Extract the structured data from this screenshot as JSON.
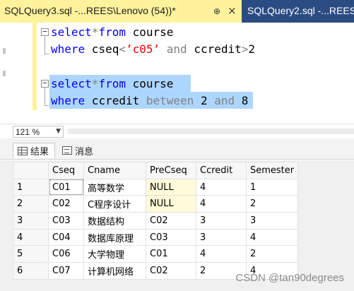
{
  "tabs": {
    "active_title": "SQLQuery3.sql -...REES\\Lenovo (54))*",
    "pin_glyph": "⊕",
    "close_glyph": "×",
    "inactive_title": "SQLQuery2.sql -...REES\\Le"
  },
  "editor": {
    "fold_glyph": "−",
    "query1": {
      "line1": {
        "kw1": "select",
        "op1": "*",
        "kw2": "from",
        "rest": " course"
      },
      "line2": {
        "kw1": "where",
        "txt1": " cseq",
        "op1": "<",
        "str1": "’c05’",
        "op2": " and ",
        "txt2": "ccredit",
        "op3": ">",
        "txt3": "2"
      }
    },
    "query2": {
      "line1": {
        "kw1": "select",
        "op1": "*",
        "kw2": "from",
        "rest": " course"
      },
      "line2": {
        "kw1": "where",
        "txt1": " ccredit ",
        "op1": "between",
        "txt2": " 2 ",
        "kw2": "and",
        "txt3": " 8"
      }
    }
  },
  "status": {
    "zoom": "121 %",
    "zoom_arrow": "▼"
  },
  "results": {
    "tab_results": "结果",
    "tab_messages": "消息",
    "columns": [
      "Cseq",
      "Cname",
      "PreCseq",
      "Ccredit",
      "Semester"
    ],
    "rows": [
      [
        "1",
        "C01",
        "高等数学",
        "NULL",
        "4",
        "1"
      ],
      [
        "2",
        "C02",
        "C程序设计",
        "NULL",
        "4",
        "2"
      ],
      [
        "3",
        "C03",
        "数据结构",
        "C02",
        "3",
        "3"
      ],
      [
        "4",
        "C04",
        "数据库原理",
        "C03",
        "3",
        "4"
      ],
      [
        "5",
        "C06",
        "大学物理",
        "C01",
        "4",
        "2"
      ],
      [
        "6",
        "C07",
        "计算机网络",
        "C02",
        "2",
        "4"
      ]
    ]
  },
  "watermark": "CSDN @tan90degrees"
}
